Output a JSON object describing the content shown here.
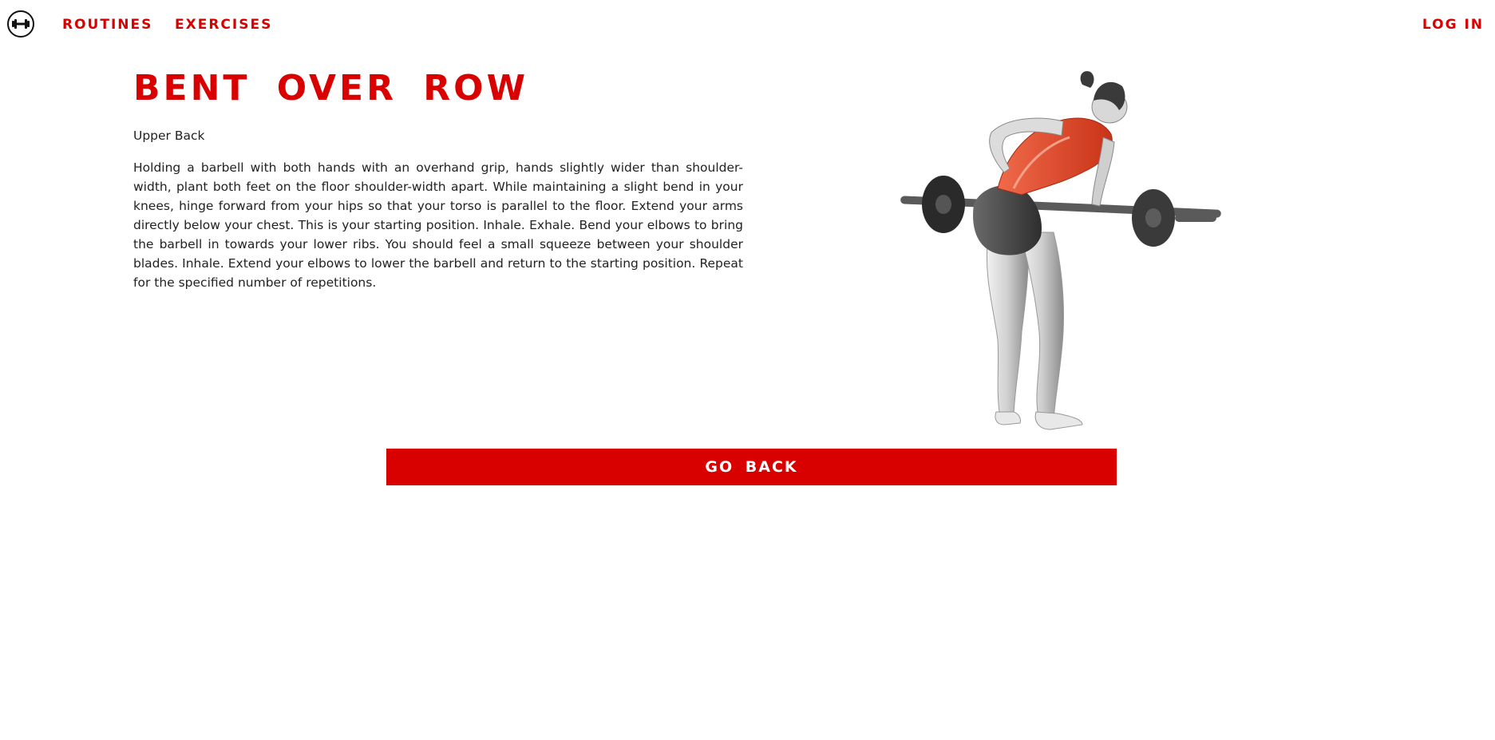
{
  "nav": {
    "logo_icon": "dumbbell-icon",
    "routines_label": "ROUTINES",
    "exercises_label": "EXERCISES",
    "login_label": "LOG IN"
  },
  "exercise": {
    "title": "BENT OVER ROW",
    "muscle": "Upper Back",
    "description": "Holding a barbell with both hands with an overhand grip, hands slightly wider than shoulder-width, plant both feet on the floor shoulder-width apart. While maintaining a slight bend in your knees, hinge forward from your hips so that your torso is parallel to the floor. Extend your arms directly below your chest. This is your starting position. Inhale. Exhale. Bend your elbows to bring the barbell in towards your lower ribs. You should feel a small squeeze between your shoulder blades. Inhale. Extend your elbows to lower the barbell and return to the starting position. Repeat for the specified number of repetitions.",
    "image_icon": "bent-over-row-figure"
  },
  "actions": {
    "go_back_label": "GO BACK"
  },
  "colors": {
    "accent": "#d90000",
    "text": "#222222",
    "background": "#ffffff"
  }
}
